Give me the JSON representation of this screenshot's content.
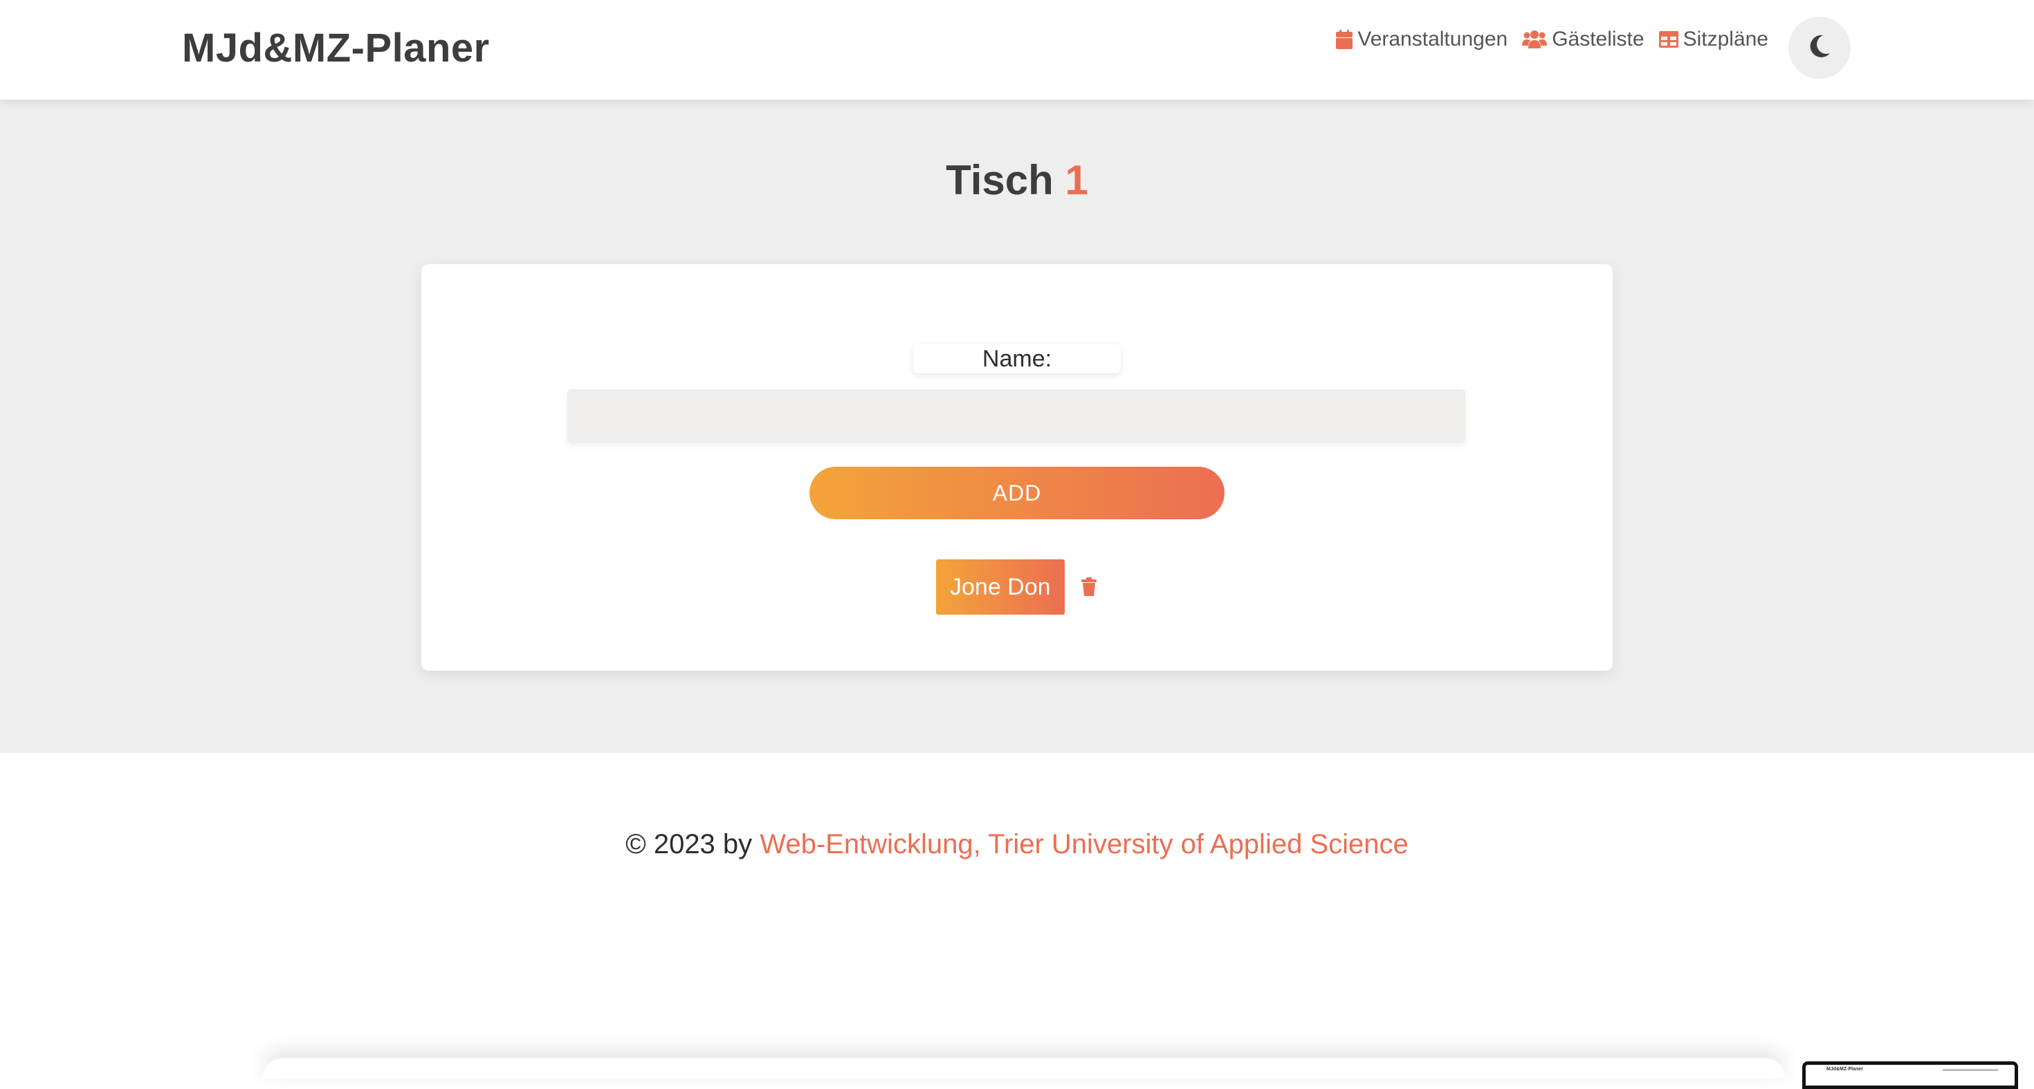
{
  "header": {
    "brand": "MJd&MZ-Planer",
    "nav": [
      {
        "label": "Veranstaltungen",
        "icon": "calendar-icon"
      },
      {
        "label": "Gästeliste",
        "icon": "users-icon"
      },
      {
        "label": "Sitzpläne",
        "icon": "table-icon"
      }
    ],
    "theme_toggle_icon": "moon-icon"
  },
  "main": {
    "title_prefix": "Tisch",
    "title_number": "1",
    "form": {
      "name_label": "Name:",
      "name_value": "",
      "name_placeholder": "",
      "add_label": "ADD"
    },
    "guests": [
      {
        "name": "Jone Don",
        "delete_icon": "trash-icon"
      }
    ]
  },
  "footer": {
    "prefix": "© 2023 by",
    "link": "Web-Entwicklung, Trier University of Applied Science"
  },
  "thumbnail": {
    "title": "MJd&MZ-Planer"
  },
  "colors": {
    "accent": "#ec6e52",
    "gradient_start": "#f3a43a",
    "gradient_end": "#ec6e52",
    "text": "#3d3d3d",
    "background": "#eeeeee"
  }
}
